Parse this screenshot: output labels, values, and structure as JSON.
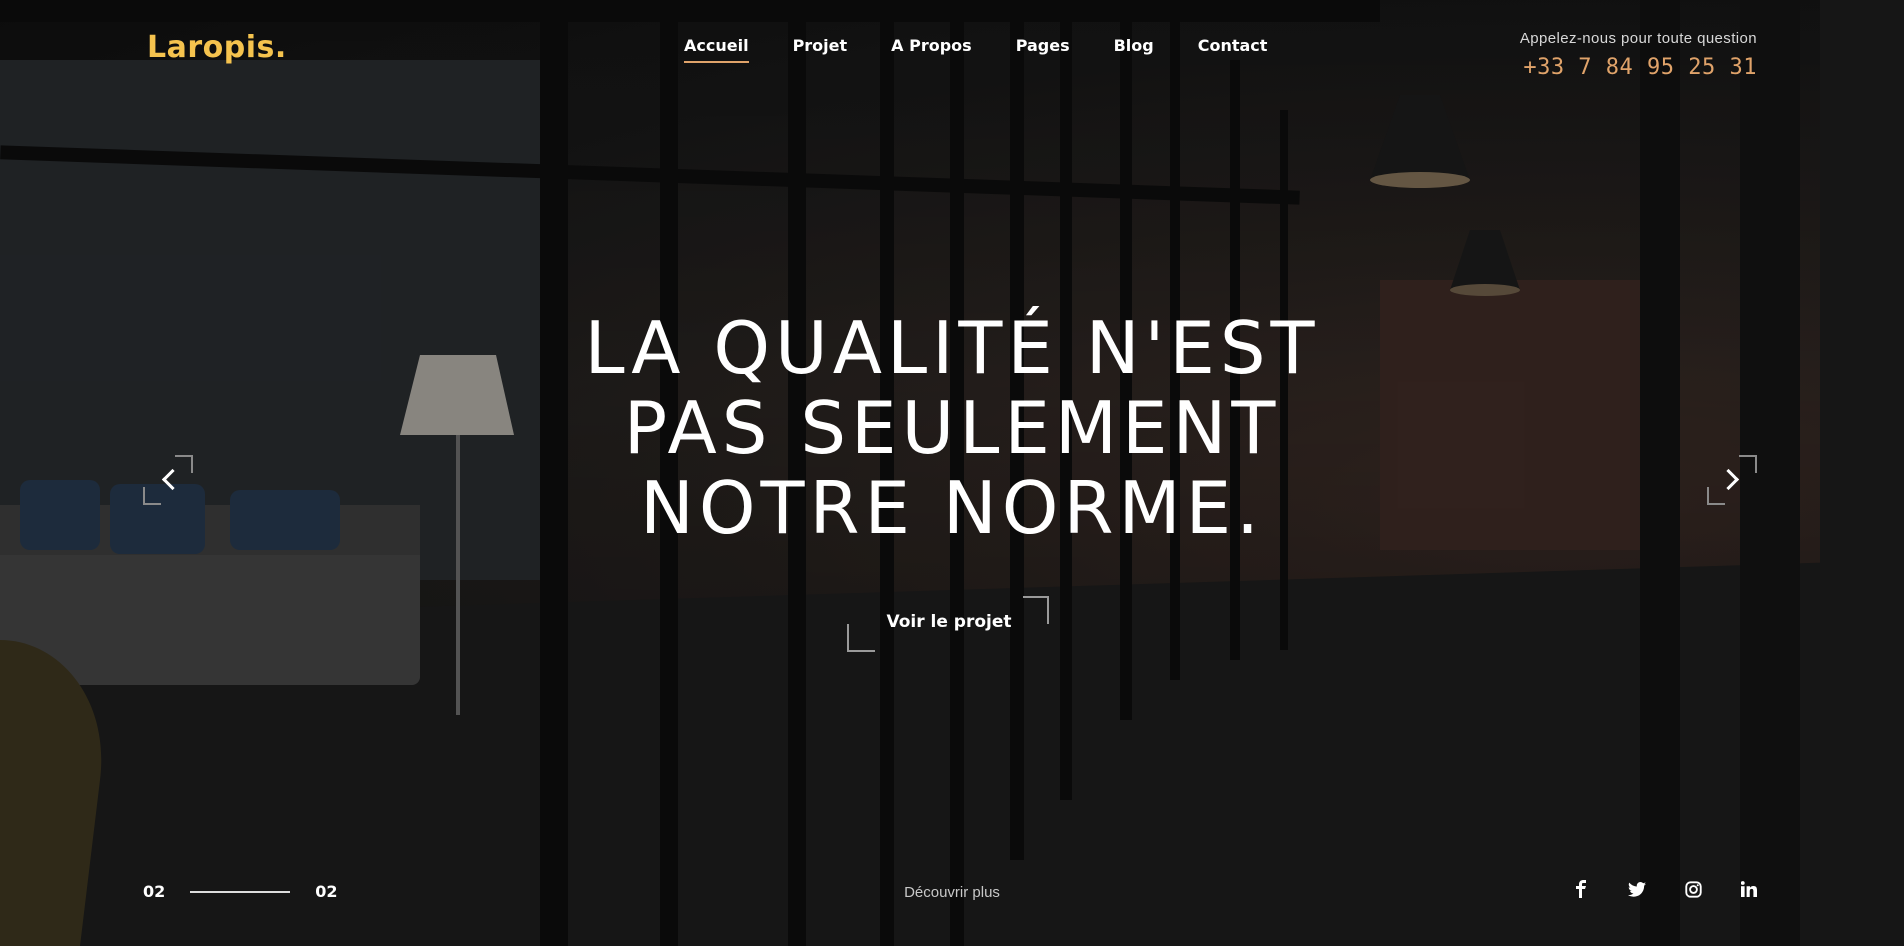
{
  "header": {
    "logo": "Laropis.",
    "nav": [
      {
        "label": "Accueil",
        "active": true
      },
      {
        "label": "Projet"
      },
      {
        "label": "A Propos"
      },
      {
        "label": "Pages"
      },
      {
        "label": "Blog"
      },
      {
        "label": "Contact"
      }
    ],
    "contact_label": "Appelez-nous pour toute question",
    "phone": "+33 7 84 95 25 31"
  },
  "hero": {
    "headline_lines": [
      "LA QUALITÉ N'EST",
      "PAS SEULEMENT",
      "NOTRE NORME."
    ],
    "cta_label": "Voir le projet"
  },
  "slider": {
    "current": "02",
    "total": "02",
    "discover_label": "Découvrir plus"
  },
  "socials": [
    "facebook-icon",
    "twitter-icon",
    "instagram-icon",
    "linkedin-icon"
  ],
  "colors": {
    "logo": "#f5c34e",
    "phone": "#e0a36a",
    "active_underline": "#e0a36a"
  }
}
